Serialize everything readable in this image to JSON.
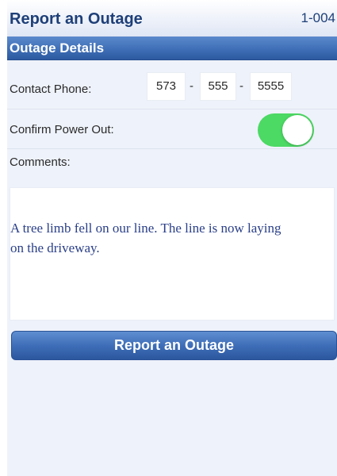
{
  "header": {
    "title": "Report an Outage",
    "record_id": "1-004"
  },
  "section": {
    "title": "Outage Details"
  },
  "contact_phone": {
    "label": "Contact Phone:",
    "area_code": "573",
    "prefix": "555",
    "line_number": "5555",
    "separator": "-"
  },
  "confirm_power_out": {
    "label": "Confirm Power Out:",
    "on": true
  },
  "comments": {
    "label": "Comments:",
    "text": "A tree limb fell on our line. The line is now laying on the driveway."
  },
  "submit_button": {
    "label": "Report an Outage"
  },
  "colors": {
    "accent_blue": "#3f6eb8",
    "toggle_on": "#4cd964",
    "title_text": "#1e3f78"
  }
}
